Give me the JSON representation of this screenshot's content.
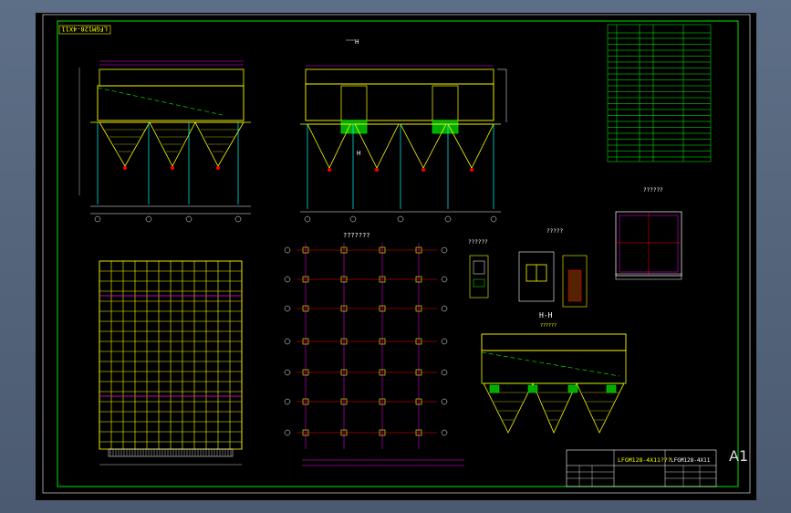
{
  "drawing": {
    "stamp_top_left": "LFGM128-4X11",
    "sheet_size_label": "A1",
    "section_marker": "H",
    "section_title": "H-H",
    "section_subtitle": "??????",
    "plan_title": "???????",
    "detail_title_1": "??????",
    "detail_title_2": "?????",
    "detail_title_3": "??????",
    "title_block_name": "LFGM128-4X11???",
    "title_block_code": "LFGM128-4X11",
    "colors": {
      "frame": "#ffffff",
      "border": "#00ff00",
      "structure": "#ffff00",
      "steel": "#ff00ff",
      "accent": "#00ff00",
      "cyan": "#00ffff",
      "red": "#ff0000"
    }
  }
}
